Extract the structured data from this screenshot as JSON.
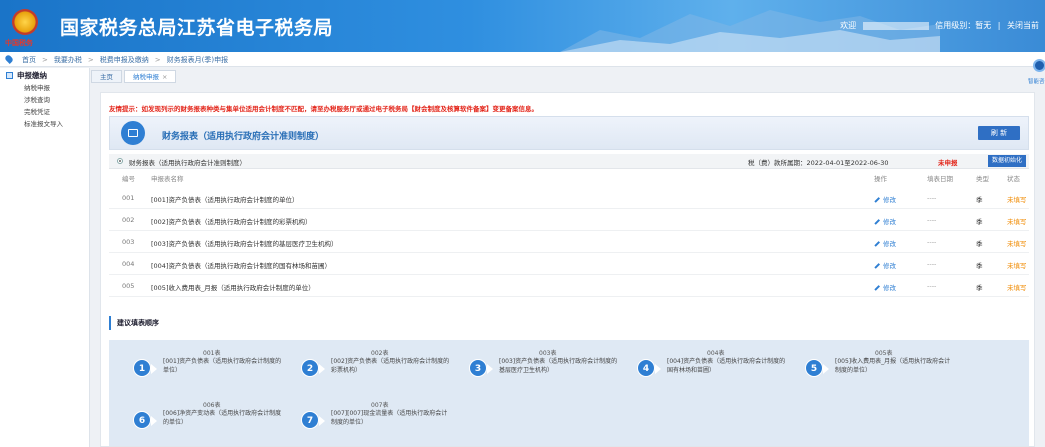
{
  "header": {
    "title": "国家税务总局江苏省电子税务局",
    "emblem_tag": "中国税务",
    "welcome": "欢迎",
    "credit": "信用级别：暂无",
    "close": "关闭当前"
  },
  "breadcrumb": {
    "items": [
      "首页",
      "我要办税",
      "税费申报及缴纳",
      "财务报表月(季)申报"
    ]
  },
  "sidebar": {
    "heading": "申报缴纳",
    "items": [
      "纳税申报",
      "涉税查询",
      "完税凭证",
      "标准报文导入"
    ]
  },
  "tabs": [
    {
      "label": "主页"
    },
    {
      "label": "纳税申报",
      "close": "×"
    }
  ],
  "notice": "友情提示：如发现列示的财务报表种类与集单位适用会计制度不匹配，请至办税服务厅或通过电子税务局【财会制度及核算软件备案】变更备案信息。",
  "title_bar": {
    "title": "财务报表（适用执行政府会计准则制度）",
    "refresh": "刷 新"
  },
  "section": {
    "name": "财务报表（适用执行政府会计准则制度）",
    "period": "税（费）款所属期：2022-04-01至2022-06-30",
    "status": "未申报",
    "init_button": "数据初始化"
  },
  "table": {
    "headers": {
      "no": "编号",
      "name": "申报表名称",
      "op": "操作",
      "date": "填表日期",
      "type": "类型",
      "status": "状态"
    },
    "rows": [
      {
        "no": "001",
        "name": "[001]资产负债表（适用执行政府会计制度的单位）",
        "op": "修改",
        "date": "----",
        "type": "季",
        "status": "未填写"
      },
      {
        "no": "002",
        "name": "[002]资产负债表（适用执行政府会计制度的彩票机构）",
        "op": "修改",
        "date": "----",
        "type": "季",
        "status": "未填写"
      },
      {
        "no": "003",
        "name": "[003]资产负债表（适用执行政府会计制度的基层医疗卫生机构）",
        "op": "修改",
        "date": "----",
        "type": "季",
        "status": "未填写"
      },
      {
        "no": "004",
        "name": "[004]资产负债表（适用执行政府会计制度的国有林场和苗圃）",
        "op": "修改",
        "date": "----",
        "type": "季",
        "status": "未填写"
      },
      {
        "no": "005",
        "name": "[005]收入费用表_月报（适用执行政府会计制度的单位）",
        "op": "修改",
        "date": "----",
        "type": "季",
        "status": "未填写"
      }
    ]
  },
  "order": {
    "title": "建议填表顺序",
    "steps": [
      {
        "n": "1",
        "code": "001表",
        "desc": "[001]资产负债表（适用执行政府会计制度的单位）"
      },
      {
        "n": "2",
        "code": "002表",
        "desc": "[002]资产负债表（适用执行政府会计制度的彩票机构）"
      },
      {
        "n": "3",
        "code": "003表",
        "desc": "[003]资产负债表（适用执行政府会计制度的基层医疗卫生机构）"
      },
      {
        "n": "4",
        "code": "004表",
        "desc": "[004]资产负债表（适用执行政府会计制度的国有林场和苗圃）"
      },
      {
        "n": "5",
        "code": "005表",
        "desc": "[005]收入费用表_月报（适用执行政府会计制度的单位）"
      },
      {
        "n": "6",
        "code": "006表",
        "desc": "[006]净资产变动表（适用执行政府会计制度的单位）"
      },
      {
        "n": "7",
        "code": "007表",
        "desc": "[007][007]现金流量表（适用执行政府会计制度的单位）"
      }
    ]
  },
  "help": {
    "label": "智能咨询"
  }
}
